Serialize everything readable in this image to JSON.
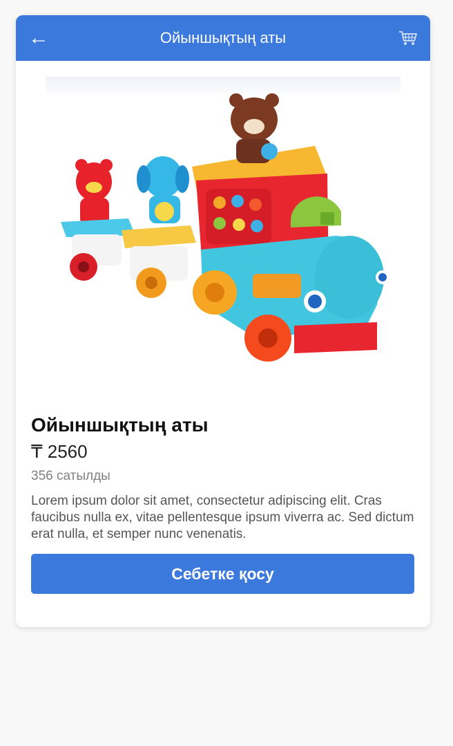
{
  "header": {
    "back_icon": "←",
    "title": "Ойыншықтың аты",
    "cart_icon": "shopping-cart-icon"
  },
  "product": {
    "image_alt": "toy-train-image",
    "title": "Ойыншықтың аты",
    "price": "₸ 2560",
    "sold": "356 сатылды",
    "description": "Lorem ipsum dolor sit amet, consectetur adipiscing elit. Cras faucibus nulla ex, vitae pellentesque ipsum viverra ac. Sed dictum erat nulla, et semper nunc venenatis."
  },
  "actions": {
    "add_to_cart_label": "Себетке қосу"
  },
  "colors": {
    "accent": "#3b79dc",
    "background": "#f8f8f8",
    "card": "#ffffff"
  }
}
